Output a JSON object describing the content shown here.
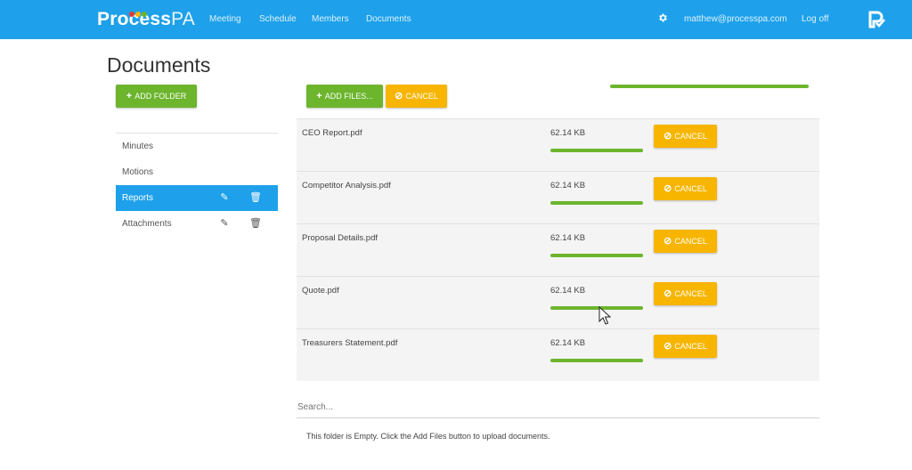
{
  "header": {
    "logo_bold": "Process",
    "logo_light": "PA",
    "nav": [
      "Meeting",
      "Schedule",
      "Members",
      "Documents"
    ],
    "user_email": "matthew@processpa.com",
    "logout": "Log off",
    "settings_icon": "gear-icon",
    "brand_icon": "processpa-mark-icon",
    "logo_dot_colors": [
      "#e53935",
      "#f7b500",
      "#6cb52d"
    ]
  },
  "page": {
    "title": "Documents"
  },
  "toolbar": {
    "add_folder": "ADD FOLDER",
    "add_files": "ADD FILES...",
    "cancel_all": "CANCEL",
    "overall_progress": 1.0
  },
  "folders": [
    {
      "label": "Minutes",
      "active": false
    },
    {
      "label": "Motions",
      "active": false
    },
    {
      "label": "Reports",
      "active": true
    },
    {
      "label": "Attachments",
      "active": false
    }
  ],
  "files": [
    {
      "name": "CEO Report.pdf",
      "size": "62.14 KB",
      "progress": 1.0,
      "cancel": "CANCEL"
    },
    {
      "name": "Competitor Analysis.pdf",
      "size": "62.14 KB",
      "progress": 1.0,
      "cancel": "CANCEL"
    },
    {
      "name": "Proposal Details.pdf",
      "size": "62.14 KB",
      "progress": 1.0,
      "cancel": "CANCEL"
    },
    {
      "name": "Quote.pdf",
      "size": "62.14 KB",
      "progress": 1.0,
      "cancel": "CANCEL"
    },
    {
      "name": "Treasurers Statement.pdf",
      "size": "62.14 KB",
      "progress": 1.0,
      "cancel": "CANCEL"
    }
  ],
  "search": {
    "placeholder": "Search..."
  },
  "empty_message": "This folder is Empty. Click the Add Files button to upload documents.",
  "colors": {
    "primary": "#1ea1ea",
    "success": "#6cb52d",
    "warning": "#f7b500"
  }
}
